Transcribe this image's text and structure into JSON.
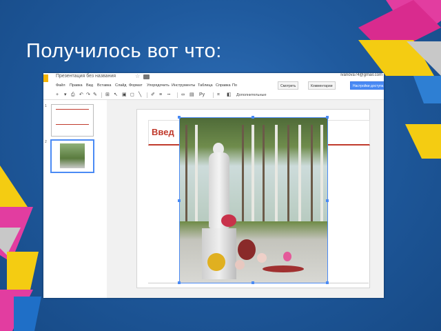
{
  "slide": {
    "title": "Получилось вот что:"
  },
  "app": {
    "doc_title": "Презентация без названия",
    "star": "☆",
    "user": "ivanova74@gmail.com",
    "menu": [
      "Файл",
      "Правка",
      "Вид",
      "Вставка",
      "Слайд",
      "Формат",
      "Упорядочить",
      "Инструменты",
      "Таблица",
      "Справка",
      "По"
    ],
    "buttons": {
      "present": "Смотреть",
      "comments": "Комментарии",
      "share": "Настройки доступа"
    },
    "toolbar_extra": "Дополнительные",
    "slide_numbers": [
      "1",
      "2"
    ]
  },
  "canvas": {
    "title_text": "Введ"
  },
  "colors": {
    "accent_red": "#c0392b",
    "selection_blue": "#4a8af4",
    "background": "#1f5a9e"
  },
  "icons": [
    "plus-icon",
    "undo-icon",
    "redo-icon",
    "print-icon",
    "paint-format-icon",
    "zoom-icon",
    "cursor-icon",
    "image-icon",
    "shape-icon",
    "line-icon",
    "comment-icon",
    "crop-icon"
  ]
}
